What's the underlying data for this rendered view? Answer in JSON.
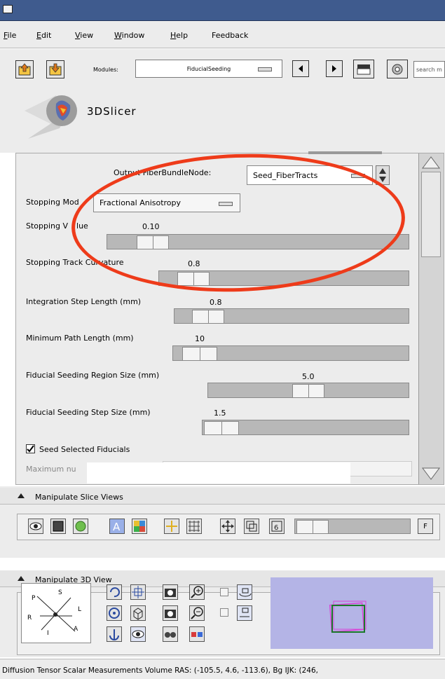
{
  "menu": {
    "items": [
      {
        "label": "File",
        "u": "F",
        "rest": "ile"
      },
      {
        "label": "Edit",
        "u": "E",
        "rest": "dit"
      },
      {
        "label": "View",
        "u": "V",
        "rest": "iew"
      },
      {
        "label": "Window",
        "u": "W",
        "rest": "indow"
      },
      {
        "label": "Help",
        "u": "H",
        "rest": "elp"
      },
      {
        "label": "Feedback",
        "u": "",
        "rest": "Feedback"
      }
    ]
  },
  "toolbar": {
    "modules_label": "Modules:",
    "module_selected": "FiducialSeeding",
    "search_placeholder": "search m"
  },
  "brand": {
    "name": "3DSlicer"
  },
  "module_panel": {
    "output_label": "Output FiberBundleNode:",
    "output_value": "Seed_FiberTracts",
    "stopping_mode_label": "Stopping Mod",
    "stopping_mode_value": "Fractional Anisotropy",
    "stopping_value_label": "Stopping V",
    "stopping_value_label2": "lue",
    "stopping_value": "0.10",
    "curvature_label": "Stopping Track Curvature",
    "curvature_value": "0.8",
    "step_length_label": "Integration Step Length (mm)",
    "step_length_value": "0.8",
    "min_path_label": "Minimum Path Length (mm)",
    "min_path_value": "10",
    "region_size_label": "Fiducial Seeding Region Size (mm)",
    "region_size_value": "5.0",
    "step_size_label": "Fiducial Seeding Step Size (mm)",
    "step_size_value": "1.5",
    "seed_selected_label": "Seed Selected Fiducials",
    "seed_selected_checked": true,
    "max_label": "Maximum nu"
  },
  "slice_views": {
    "title": "Manipulate Slice Views",
    "fov_label": "F"
  },
  "view3d": {
    "title": "Manipulate 3D View",
    "axes": {
      "S": "S",
      "P": "P",
      "L": "L",
      "R": "R",
      "I": "I",
      "A": "A"
    }
  },
  "status_bar": {
    "text": "Diffusion Tensor Scalar Measurements Volume RAS: (-105.5, 4.6, -113.6), Bg IJK: (246,"
  },
  "colors": {
    "titlebar": "#3f5b8e",
    "annotation": "#ee3b1a",
    "preview_bg": "#b4b4e6"
  }
}
